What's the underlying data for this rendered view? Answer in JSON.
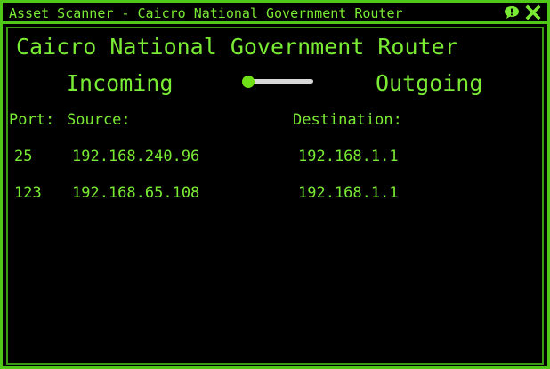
{
  "window": {
    "title": "Asset Scanner - Caicro National Government Router"
  },
  "router": {
    "name": "Caicro National Government Router"
  },
  "direction_toggle": {
    "incoming_label": "Incoming",
    "outgoing_label": "Outgoing",
    "selected": "Incoming"
  },
  "table": {
    "headers": {
      "port": "Port:",
      "source": "Source:",
      "destination": "Destination:"
    },
    "rows": [
      {
        "port": "25",
        "source": "192.168.240.96",
        "destination": "192.168.1.1"
      },
      {
        "port": "123",
        "source": "192.168.65.108",
        "destination": "192.168.1.1"
      }
    ]
  },
  "icons": {
    "chat": "chat-bubble-icon",
    "close": "close-icon"
  },
  "colors": {
    "accent": "#7aeb34",
    "border": "#4fc81a",
    "background": "#000000",
    "toggle_track": "#d8d8d8"
  }
}
